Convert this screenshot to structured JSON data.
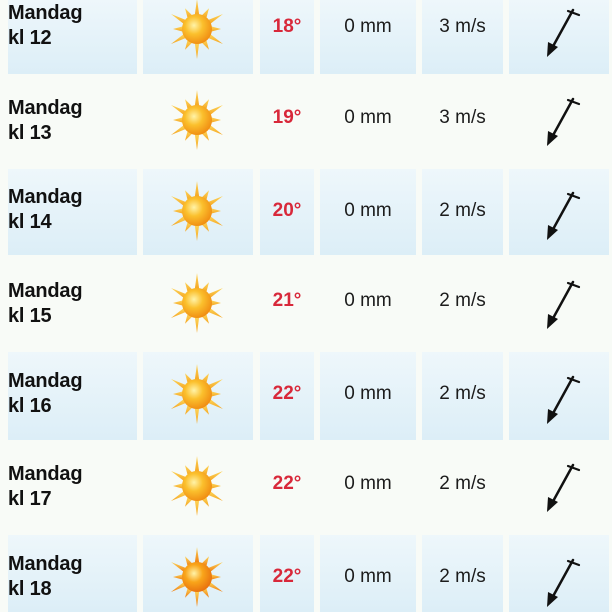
{
  "forecast": {
    "rows": [
      {
        "day": "Mandag",
        "hour": "kl 12",
        "weather_icon": "sun-icon",
        "temperature": "18°",
        "precipitation": "0 mm",
        "wind_speed": "3 m/s",
        "wind_direction_icon": "wind-arrow-icon"
      },
      {
        "day": "Mandag",
        "hour": "kl 13",
        "weather_icon": "sun-icon",
        "temperature": "19°",
        "precipitation": "0 mm",
        "wind_speed": "3 m/s",
        "wind_direction_icon": "wind-arrow-icon"
      },
      {
        "day": "Mandag",
        "hour": "kl 14",
        "weather_icon": "sun-icon",
        "temperature": "20°",
        "precipitation": "0 mm",
        "wind_speed": "2 m/s",
        "wind_direction_icon": "wind-arrow-icon"
      },
      {
        "day": "Mandag",
        "hour": "kl 15",
        "weather_icon": "sun-icon",
        "temperature": "21°",
        "precipitation": "0 mm",
        "wind_speed": "2 m/s",
        "wind_direction_icon": "wind-arrow-icon"
      },
      {
        "day": "Mandag",
        "hour": "kl 16",
        "weather_icon": "sun-icon",
        "temperature": "22°",
        "precipitation": "0 mm",
        "wind_speed": "2 m/s",
        "wind_direction_icon": "wind-arrow-icon"
      },
      {
        "day": "Mandag",
        "hour": "kl 17",
        "weather_icon": "sun-icon",
        "temperature": "22°",
        "precipitation": "0 mm",
        "wind_speed": "2 m/s",
        "wind_direction_icon": "wind-arrow-icon"
      },
      {
        "day": "Mandag",
        "hour": "kl 18",
        "weather_icon": "sun-icon",
        "temperature": "22°",
        "precipitation": "0 mm",
        "wind_speed": "2 m/s",
        "wind_direction_icon": "wind-arrow-icon"
      }
    ]
  },
  "colors": {
    "temperature": "#d8283a",
    "text": "#111111",
    "row_tint_top": "#eef7fb",
    "row_tint_bottom": "#dceef7",
    "sun_core": "#f7a51e",
    "sun_rays": "#f9b233"
  }
}
